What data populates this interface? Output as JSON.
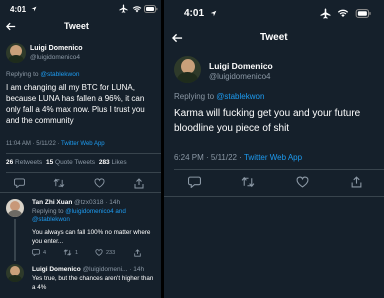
{
  "left": {
    "status_time": "4:01",
    "header_title": "Tweet",
    "main_tweet": {
      "name": "Luigi Domenico",
      "handle": "@luigidomenico4",
      "replying_prefix": "Replying to",
      "replying_to": "@stablekwon",
      "text": "I am changing all my BTC for LUNA, because LUNA has fallen a 96%, it can only fall a 4% max now. Plus I trust you and the community",
      "timestamp": "11:04 AM · 5/11/22 · ",
      "source": "Twitter Web App",
      "retweets_count": "26",
      "retweets_label": "Retweets",
      "quotes_count": "15",
      "quotes_label": "Quote Tweets",
      "likes_count": "283",
      "likes_label": "Likes"
    },
    "reply1": {
      "name": "Tan Zhi Xuan",
      "handle_time": "@tzx0318 · 14h",
      "replying_prefix": "Replying to",
      "replying_to": "@luigidomenico4 and @stablekwon",
      "text": "You always can fall 100% no matter where you enter...",
      "reply_count": "4",
      "retweet_count": "1",
      "like_count": "233"
    },
    "reply2": {
      "name": "Luigi Domenico",
      "handle_time": "@luigidomeni... · 14h",
      "text": "Yes true, but the chances aren't higher than a 4%"
    }
  },
  "right": {
    "status_time": "4:01",
    "header_title": "Tweet",
    "tweet": {
      "name": "Luigi Domenico",
      "handle": "@luigidomenico4",
      "replying_prefix": "Replying to",
      "replying_to": "@stablekwon",
      "text": "Karma will fucking get you and your future bloodline you piece of shit",
      "timestamp": "6:24 PM · 5/11/22 · ",
      "source": "Twitter Web App"
    }
  },
  "colors": {
    "background": "#15202b",
    "accent": "#1d9bf0",
    "secondary_text": "#8b98a5",
    "divider": "#38444d"
  },
  "icons": [
    "location-arrow-icon",
    "airplane-icon",
    "wifi-icon",
    "battery-icon",
    "back-arrow-icon",
    "reply-icon",
    "retweet-icon",
    "like-icon",
    "share-icon"
  ]
}
